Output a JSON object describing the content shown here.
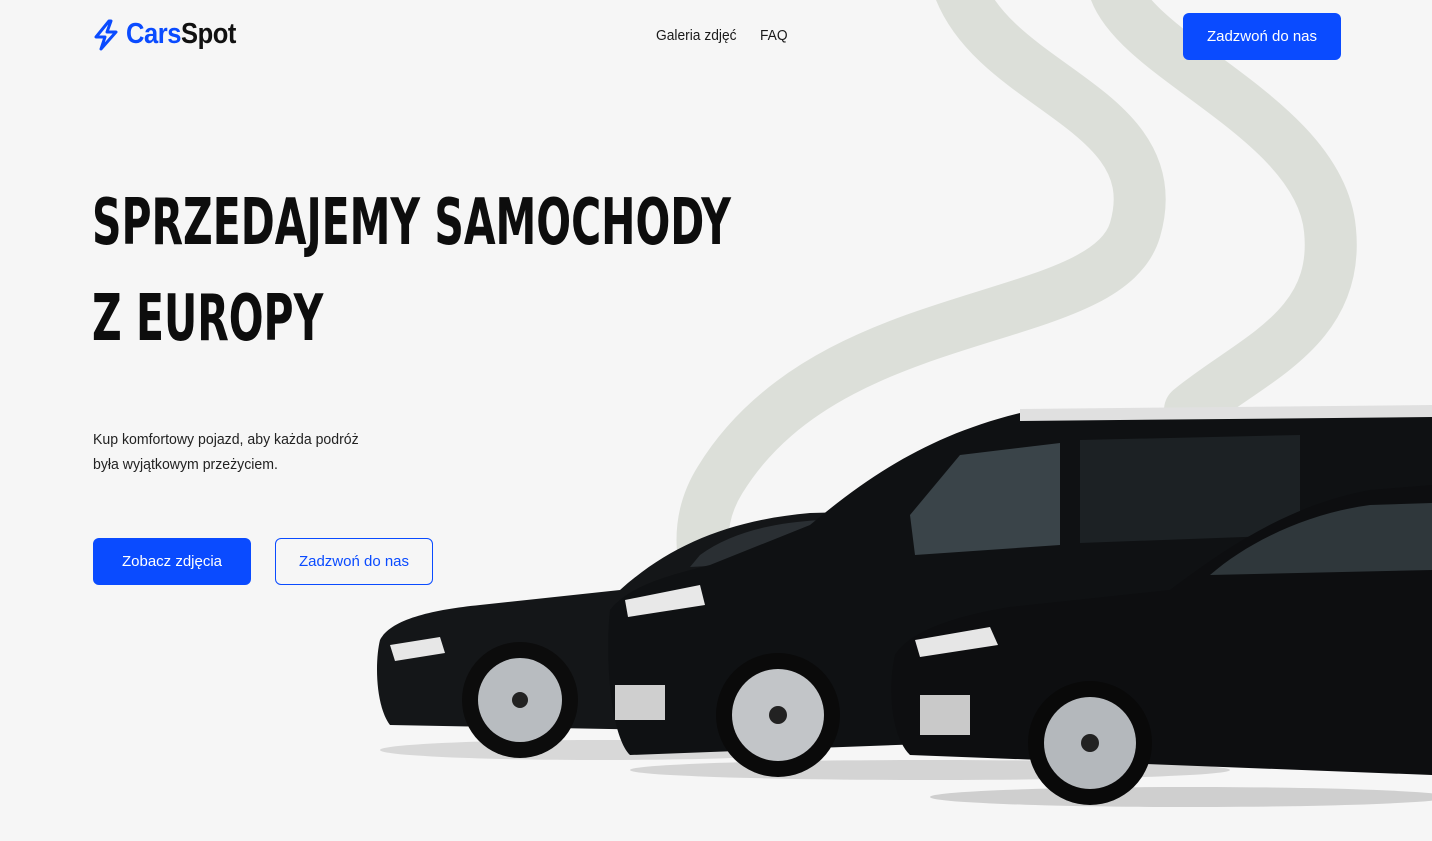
{
  "header": {
    "logo_part1": "Cars",
    "logo_part2": "Spot",
    "nav": [
      {
        "label": "Galeria zdjęć"
      },
      {
        "label": "FAQ"
      }
    ],
    "cta_label": "Zadzwoń do nas"
  },
  "hero": {
    "title_line1": "SPRZEDAJEMY SAMOCHODY",
    "title_line2": "Z EUROPY",
    "description_line1": "Kup komfortowy pojazd, aby każda podróż",
    "description_line2": "była wyjątkowym przeżyciem.",
    "primary_button": "Zobacz zdjęcia",
    "secondary_button": "Zadzwoń do nas"
  },
  "colors": {
    "accent": "#0a4bff",
    "background": "#f6f6f6",
    "swoosh": "#dcdfd9",
    "text": "#0d0d0d"
  },
  "icons": {
    "logo_icon": "lightning-bolt-icon"
  }
}
